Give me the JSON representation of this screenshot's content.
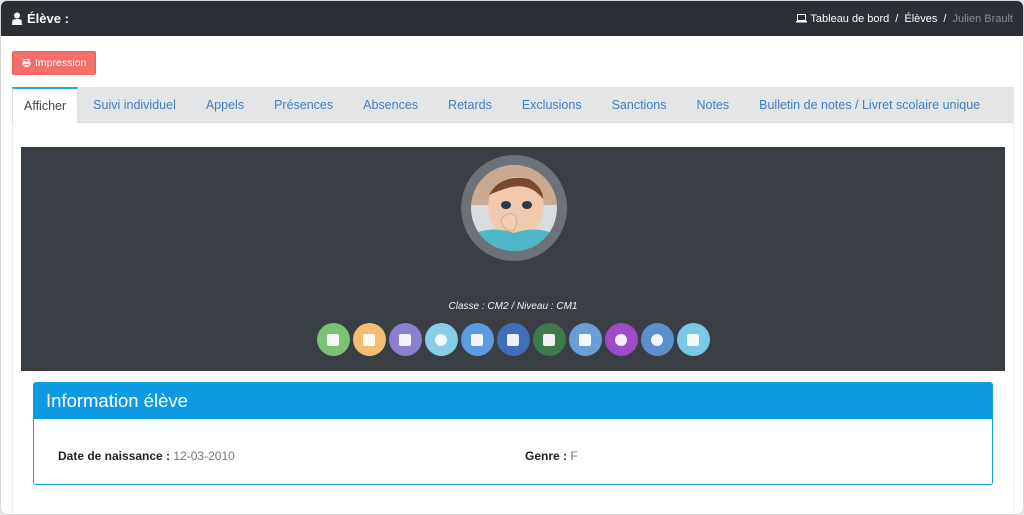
{
  "header": {
    "title": "Élève :",
    "breadcrumb": [
      "Tableau de bord",
      "Élèves",
      "Julien Brault"
    ]
  },
  "toolbar": {
    "print_label": "Impression"
  },
  "tabs": [
    {
      "label": "Afficher",
      "active": true
    },
    {
      "label": "Suivi individuel"
    },
    {
      "label": "Appels"
    },
    {
      "label": "Présences"
    },
    {
      "label": "Absences"
    },
    {
      "label": "Retards"
    },
    {
      "label": "Exclusions"
    },
    {
      "label": "Sanctions"
    },
    {
      "label": "Notes"
    },
    {
      "label": "Bulletin de notes / Livret scolaire unique"
    }
  ],
  "profile": {
    "classe_text": "Classe : CM2 / Niveau : CM1",
    "action_buttons": [
      {
        "icon": "check-square-icon",
        "color": "#7bc275"
      },
      {
        "icon": "edit-icon",
        "color": "#f4bd71"
      },
      {
        "icon": "document-icon",
        "color": "#8b7fcf"
      },
      {
        "icon": "user-icon",
        "color": "#86cde6"
      },
      {
        "icon": "flag-icon",
        "color": "#5b9be0"
      },
      {
        "icon": "report-icon",
        "color": "#3f6fb8"
      },
      {
        "icon": "table-icon",
        "color": "#3e7a4b"
      },
      {
        "icon": "calendar-icon",
        "color": "#6a9fd6"
      },
      {
        "icon": "chat-icon",
        "color": "#9d4bc6"
      },
      {
        "icon": "circle-icon",
        "color": "#5a8fcc"
      },
      {
        "icon": "tag-icon",
        "color": "#79c8e6"
      }
    ]
  },
  "info_panel": {
    "title": "Information élève",
    "birth_label": "Date de naissance :",
    "birth_value": "12-03-2010",
    "gender_label": "Genre :",
    "gender_value": "F"
  },
  "colors": {
    "topbar": "#2b2f36",
    "print_button": "#f56f6a",
    "tab_link": "#3f7fc0",
    "hero": "#3a3f46",
    "panel_accent": "#0e9ae3"
  }
}
